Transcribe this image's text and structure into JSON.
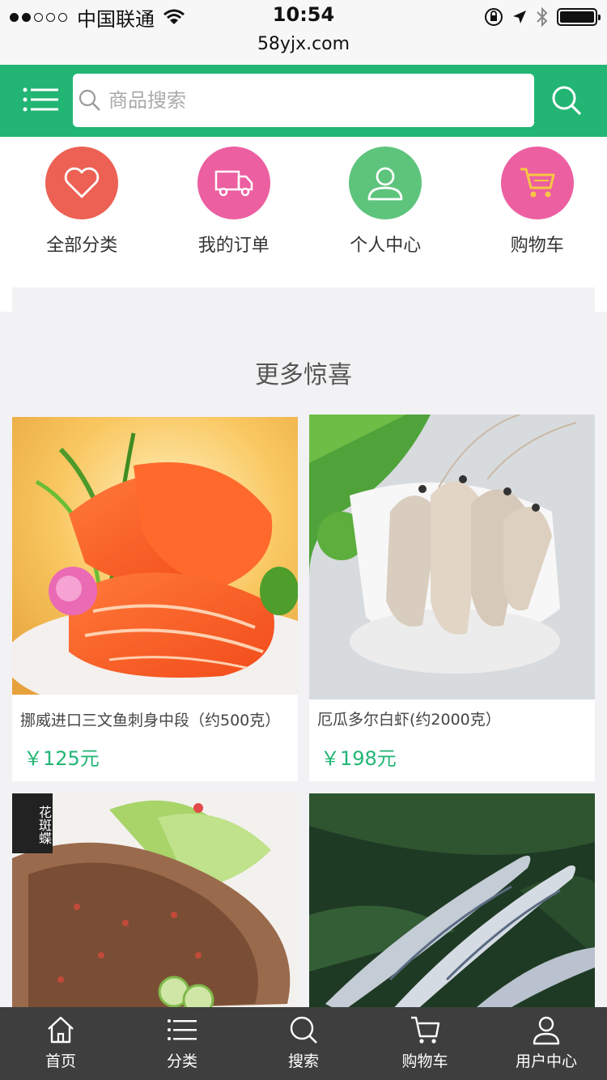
{
  "status_bar": {
    "carrier": "中国联通",
    "time": "10:54",
    "url": "58yjx.com"
  },
  "header": {
    "search_placeholder": "商品搜索",
    "accent_color": "#22b574"
  },
  "quick_nav": [
    {
      "label": "全部分类",
      "icon": "heart-icon",
      "color": "#ec6154"
    },
    {
      "label": "我的订单",
      "icon": "truck-icon",
      "color": "#ec5fa0"
    },
    {
      "label": "个人中心",
      "icon": "user-icon",
      "color": "#5ec47c"
    },
    {
      "label": "购物车",
      "icon": "cart-icon",
      "color": "#ec5fa0"
    }
  ],
  "section": {
    "title": "更多惊喜"
  },
  "products": [
    {
      "name": "挪威进口三文鱼刺身中段（约500克）",
      "price": "￥125元",
      "image": "salmon-sashimi"
    },
    {
      "name": "厄瓜多尔白虾(约2000克）",
      "price": "￥198元",
      "image": "white-shrimp"
    },
    {
      "name": "",
      "price": "",
      "image": "flounder",
      "badge": "花斑蝶"
    },
    {
      "name": "",
      "price": "",
      "image": "sardines"
    }
  ],
  "tab_bar": [
    {
      "label": "首页",
      "icon": "home-icon"
    },
    {
      "label": "分类",
      "icon": "list-icon"
    },
    {
      "label": "搜索",
      "icon": "search-icon"
    },
    {
      "label": "购物车",
      "icon": "cart-icon"
    },
    {
      "label": "用户中心",
      "icon": "user-icon"
    }
  ]
}
